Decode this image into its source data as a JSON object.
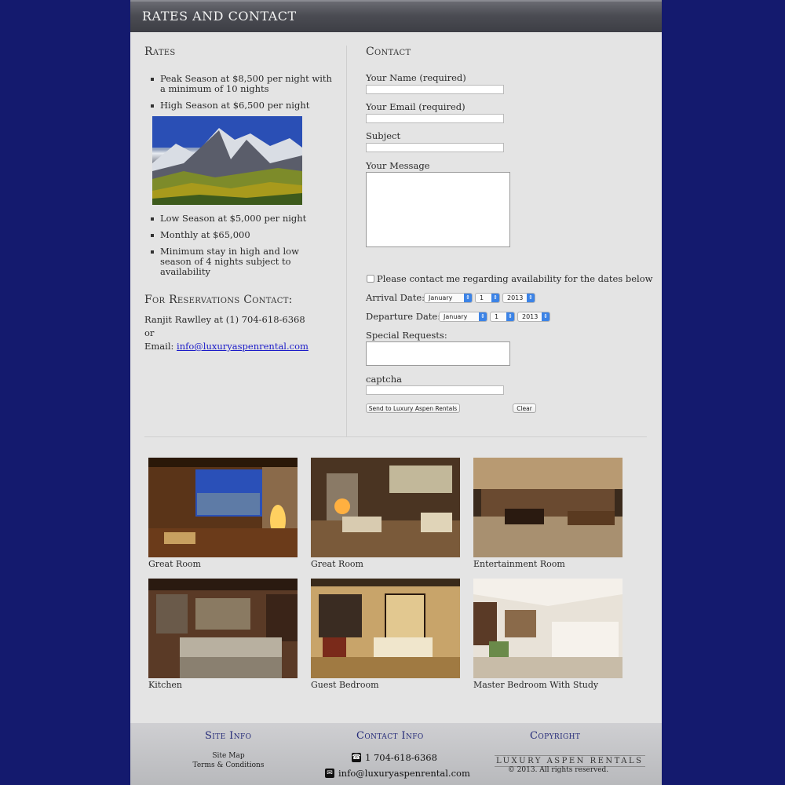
{
  "header": {
    "title": "RATES AND CONTACT"
  },
  "rates": {
    "heading": "Rates",
    "items_top": [
      "Peak Season at $8,500 per night with a minimum of 10 nights",
      "High Season at $6,500 per night"
    ],
    "items_bottom": [
      "Low Season at $5,000 per night",
      "Monthly at $65,000",
      "Minimum stay in high and low season of 4 nights subject to availability"
    ]
  },
  "reservations": {
    "heading": "For Reservations Contact:",
    "line1": "Ranjit Rawlley at (1) 704-618-6368",
    "line2": "or",
    "email_label": "Email: ",
    "email_link": "info@luxuryaspenrental.com"
  },
  "contact_form": {
    "heading": "Contact",
    "name_label": "Your Name (required)",
    "email_label": "Your Email (required)",
    "subject_label": "Subject",
    "message_label": "Your Message",
    "checkbox_label": "Please contact me regarding availability for the dates below",
    "arrival_label": "Arrival Date:",
    "departure_label": "Departure Date:",
    "arrival": {
      "month": "January",
      "day": "1",
      "year": "2013"
    },
    "departure": {
      "month": "January",
      "day": "1",
      "year": "2013"
    },
    "special_label": "Special Requests:",
    "captcha_label": "captcha",
    "send_button": "Send to Luxury Aspen Rentals",
    "clear_button": "Clear"
  },
  "gallery": [
    {
      "caption": "Great Room"
    },
    {
      "caption": "Great Room"
    },
    {
      "caption": "Entertainment Room"
    },
    {
      "caption": "Kitchen"
    },
    {
      "caption": "Guest Bedroom"
    },
    {
      "caption": "Master Bedroom With Study"
    }
  ],
  "footer": {
    "site_info": {
      "heading": "Site Info",
      "links": [
        "Site Map",
        "Terms & Conditions"
      ]
    },
    "contact_info": {
      "heading": "Contact Info",
      "phone": "1 704-618-6368",
      "email": "info@luxuryaspenrental.com"
    },
    "copyright": {
      "heading": "Copyright",
      "logo_text": "LUXURY ASPEN RENTALS",
      "text": "© 2013. All rights reserved."
    }
  },
  "colors": {
    "background": "#141a6e",
    "page": "#e4e4e4",
    "header": "#4b4c53",
    "footer_heading": "#242a78",
    "link": "#1a1ac8",
    "select_arrow": "#3c83e6"
  }
}
